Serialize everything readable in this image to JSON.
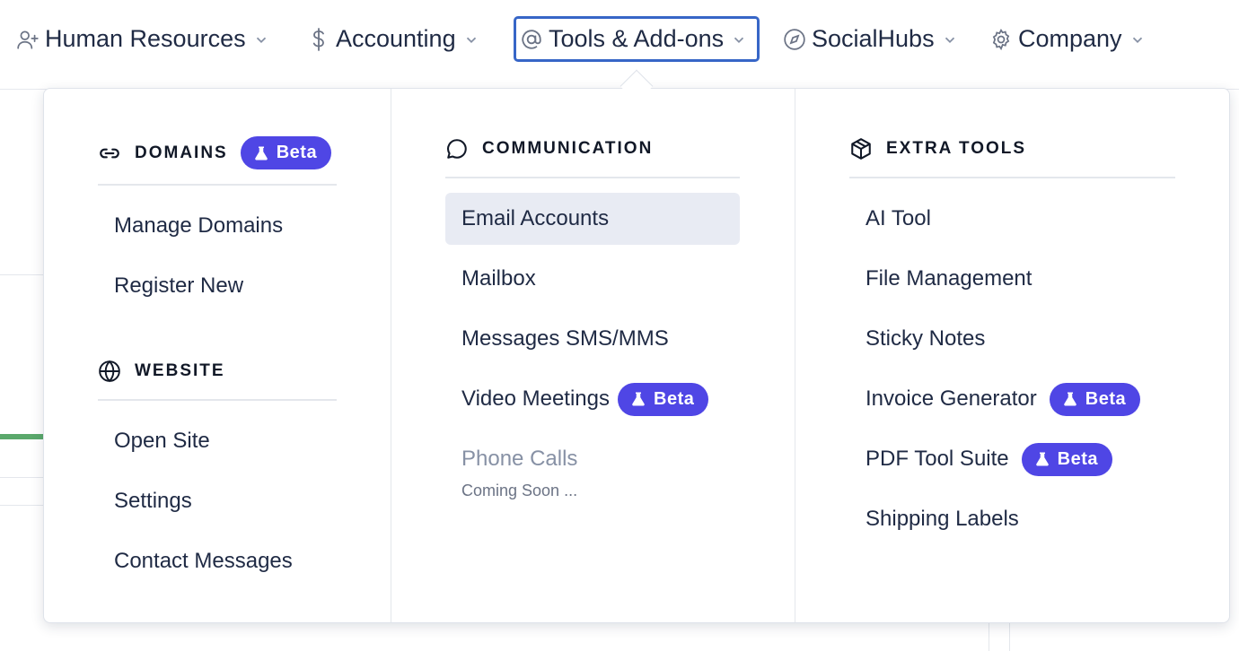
{
  "nav": {
    "items": [
      {
        "label": "Human Resources",
        "icon": "user-plus-icon"
      },
      {
        "label": "Accounting",
        "icon": "dollar-icon"
      },
      {
        "label": "Tools & Add-ons",
        "icon": "at-sign-icon"
      },
      {
        "label": "SocialHubs",
        "icon": "compass-icon"
      },
      {
        "label": "Company",
        "icon": "gear-icon"
      }
    ]
  },
  "menu": {
    "domains": {
      "title": "DOMAINS",
      "badge": "Beta",
      "items": [
        "Manage Domains",
        "Register New"
      ]
    },
    "website": {
      "title": "WEBSITE",
      "items": [
        "Open Site",
        "Settings",
        "Contact Messages"
      ]
    },
    "communication": {
      "title": "COMMUNICATION",
      "items": [
        "Email Accounts",
        "Mailbox",
        "Messages SMS/MMS",
        "Video Meetings",
        "Phone Calls"
      ],
      "video_badge": "Beta",
      "phone_note": "Coming Soon ..."
    },
    "extra": {
      "title": "EXTRA TOOLS",
      "items": [
        "AI Tool",
        "File Management",
        "Sticky Notes",
        "Invoice Generator",
        "PDF Tool Suite",
        "Shipping Labels"
      ],
      "invoice_badge": "Beta",
      "pdf_badge": "Beta"
    }
  },
  "colors": {
    "accent": "#4f46e5",
    "active_border": "#3766c7",
    "highlight": "#e8ebf3"
  }
}
